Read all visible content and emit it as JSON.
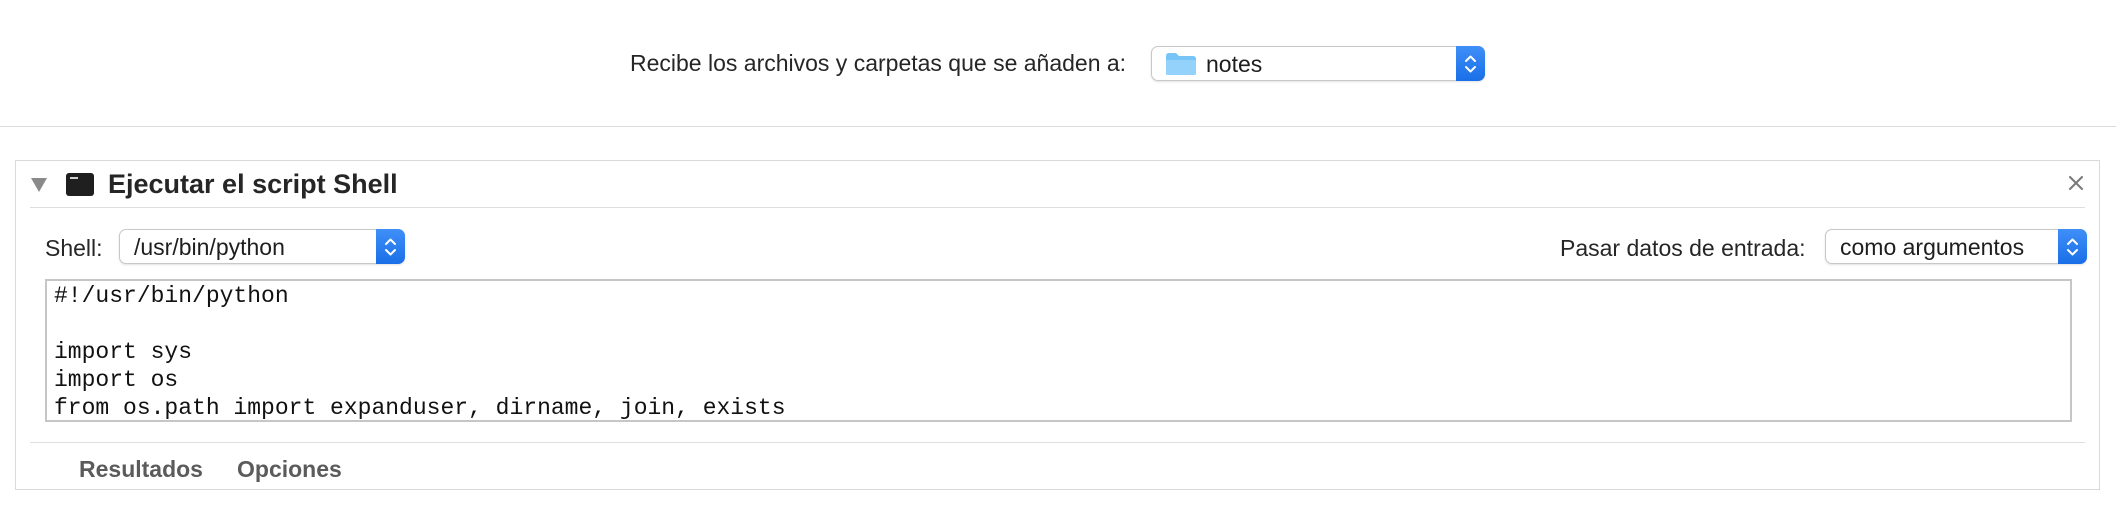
{
  "receive": {
    "label": "Recibe los archivos y carpetas que se añaden a:",
    "folder_value": "notes",
    "folder_icon": "folder-icon"
  },
  "action": {
    "title": "Ejecutar el script Shell",
    "icon": "terminal-icon",
    "shell_label": "Shell:",
    "shell_value": "/usr/bin/python",
    "pass_input_label": "Pasar datos de entrada:",
    "pass_input_value": "como argumentos",
    "script_lines": [
      "#!/usr/bin/python",
      "",
      "import sys",
      "import os",
      "from os.path import expanduser, dirname, join, exists"
    ],
    "tabs": [
      "Resultados",
      "Opciones"
    ]
  },
  "colors": {
    "accent": "#1a6fe8",
    "folder": "#79c4f7"
  }
}
